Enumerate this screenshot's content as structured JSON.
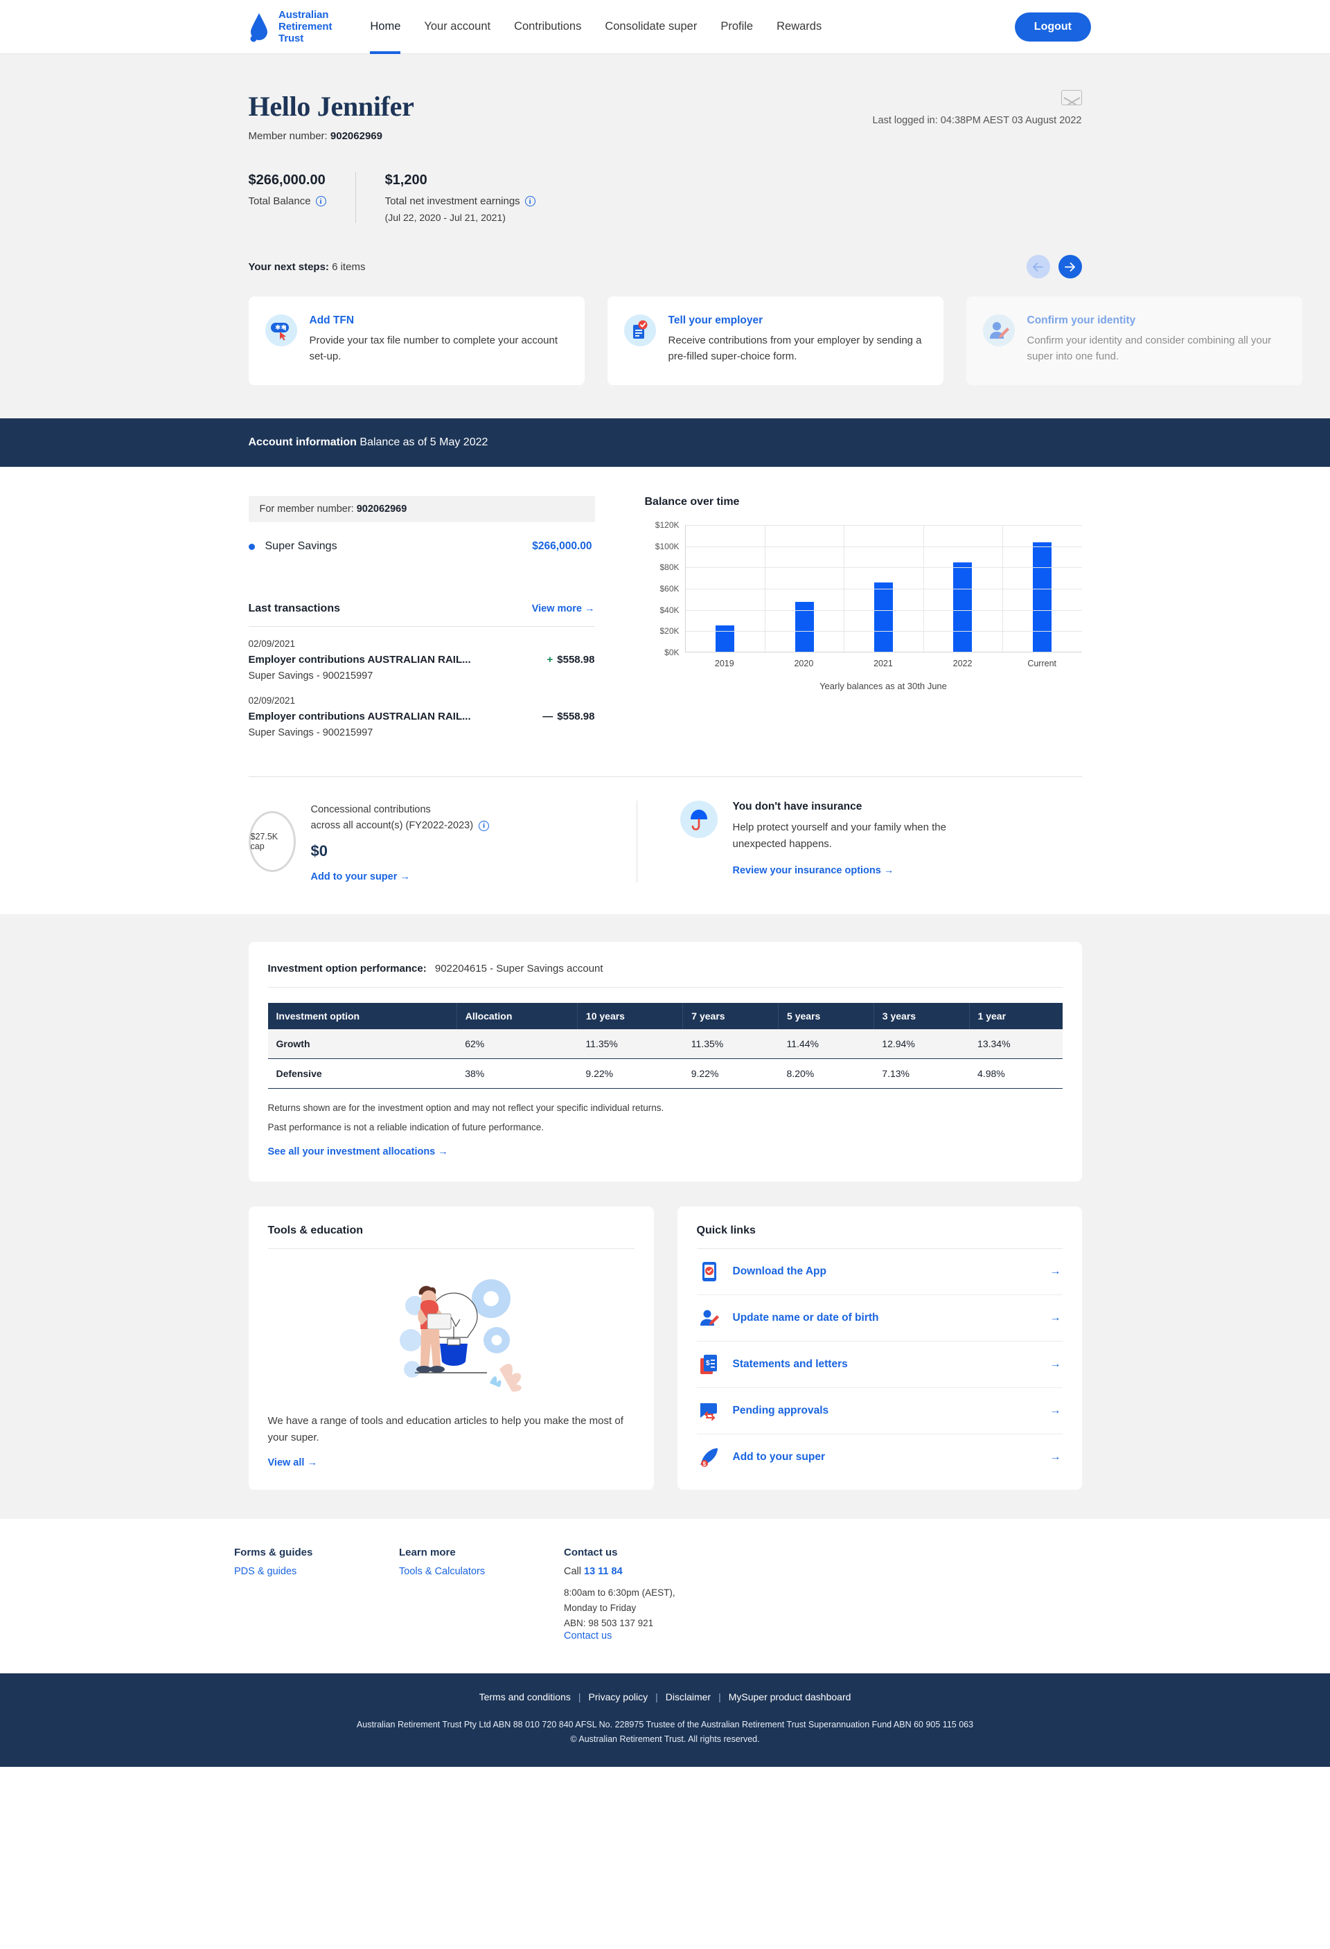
{
  "header": {
    "brand": {
      "line1": "Australian",
      "line2": "Retirement",
      "line3": "Trust"
    },
    "nav": [
      {
        "label": "Home",
        "active": true
      },
      {
        "label": "Your account",
        "active": false
      },
      {
        "label": "Contributions",
        "active": false
      },
      {
        "label": "Consolidate super",
        "active": false
      },
      {
        "label": "Profile",
        "active": false
      },
      {
        "label": "Rewards",
        "active": false
      }
    ],
    "logout_label": "Logout"
  },
  "hero": {
    "greeting": "Hello Jennifer",
    "member_label": "Member number:",
    "member_number": "902062969",
    "last_logged_in": "Last logged in: 04:38PM AEST 03 August 2022",
    "stats": [
      {
        "value": "$266,000.00",
        "label": "Total Balance",
        "sub": ""
      },
      {
        "value": "$1,200",
        "label": "Total net investment earnings",
        "sub": "(Jul 22, 2020 - Jul 21, 2021)"
      }
    ]
  },
  "next_steps": {
    "title_bold": "Your next steps:",
    "title_rest": "6 items",
    "prev_label": "←",
    "next_label": "→",
    "cards": [
      {
        "icon": "tfn-badge-icon",
        "title": "Add TFN",
        "desc": "Provide your tax file number to complete your account set-up."
      },
      {
        "icon": "clipboard-check-icon",
        "title": "Tell your employer",
        "desc": "Receive contributions from your employer by sending a pre-filled super-choice form."
      },
      {
        "icon": "person-edit-icon",
        "title": "Confirm your identity",
        "desc": "Confirm your identity and consider combining all your super into one fund."
      }
    ]
  },
  "account_bar": {
    "title": "Account information",
    "subtitle": "Balance as of 5 May 2022"
  },
  "account": {
    "member_pill_label": "For member number:",
    "member_pill_number": "902062969",
    "account_name": "Super Savings",
    "account_amount": "$266,000.00",
    "transactions_title": "Last transactions",
    "view_more": "View more →",
    "transactions": [
      {
        "date": "02/09/2021",
        "description": "Employer contributions AUSTRALIAN RAIL...",
        "sign": "+",
        "amount": "$558.98",
        "sub": "Super Savings - 900215997"
      },
      {
        "date": "02/09/2021",
        "description": "Employer contributions AUSTRALIAN RAIL...",
        "sign": "—",
        "amount": "$558.98",
        "sub": "Super Savings - 900215997"
      }
    ]
  },
  "chart_data": {
    "type": "bar",
    "title": "Balance over time",
    "categories": [
      "2019",
      "2020",
      "2021",
      "2022",
      "Current"
    ],
    "values": [
      25000,
      47000,
      65000,
      84000,
      103000
    ],
    "xlabel": "Yearly balances as at 30th June",
    "ylabel": "",
    "ylim": [
      0,
      120000
    ],
    "ytick_labels": [
      "$0K",
      "$20K",
      "$40K",
      "$60K",
      "$80K",
      "$100K",
      "$120K"
    ],
    "ytick_values": [
      0,
      20000,
      40000,
      60000,
      80000,
      100000,
      120000
    ],
    "grid": true,
    "legend": "none",
    "bar_color": "#0a5cf5"
  },
  "contributions": {
    "cap_label": "$27.5K cap",
    "line1": "Concessional contributions",
    "line2": "across all account(s) (FY2022-2023)",
    "amount": "$0",
    "link": "Add to your super →"
  },
  "insurance": {
    "icon": "umbrella-icon",
    "title": "You don't have insurance",
    "desc": "Help protect yourself and your family when the unexpected happens.",
    "link": "Review your insurance options →"
  },
  "investment": {
    "head_label": "Investment option performance:",
    "head_value": "902204615 - Super Savings account",
    "columns": [
      "Investment option",
      "Allocation",
      "10 years",
      "7 years",
      "5 years",
      "3 years",
      "1 year"
    ],
    "rows": [
      [
        "Growth",
        "62%",
        "11.35%",
        "11.35%",
        "11.44%",
        "12.94%",
        "13.34%"
      ],
      [
        "Defensive",
        "38%",
        "9.22%",
        "9.22%",
        "8.20%",
        "7.13%",
        "4.98%"
      ]
    ],
    "note1": "Returns shown are for the investment option and may not reflect your specific individual returns.",
    "note2": "Past performance is not a reliable indication of future performance.",
    "link": "See all your investment allocations →"
  },
  "tools": {
    "title": "Tools & education",
    "desc": "We have a range of tools and education articles to help you make the most of your super.",
    "link": "View all →"
  },
  "quick_links": {
    "title": "Quick links",
    "items": [
      {
        "icon": "mobile-app-icon",
        "label": "Download the App",
        "arrow": "→"
      },
      {
        "icon": "person-edit-icon",
        "label": "Update name or date of birth",
        "arrow": "→"
      },
      {
        "icon": "document-dollar-icon",
        "label": "Statements and letters",
        "arrow": "→"
      },
      {
        "icon": "chat-approval-icon",
        "label": "Pending approvals",
        "arrow": "→"
      },
      {
        "icon": "rocket-dollar-icon",
        "label": "Add to your super",
        "arrow": "→"
      }
    ]
  },
  "footer": {
    "columns": [
      {
        "heading": "Forms & guides",
        "link": "PDS & guides"
      },
      {
        "heading": "Learn more",
        "link": "Tools & Calculators"
      }
    ],
    "contact": {
      "heading": "Contact us",
      "call_prefix": "Call",
      "phone": "13 11 84",
      "hours_line1": "8:00am to 6:30pm (AEST),",
      "hours_line2": "Monday to Friday",
      "abn": "ABN: 98 503 137 921",
      "link": "Contact us"
    },
    "bottom_links": [
      "Terms and conditions",
      "Privacy policy",
      "Disclaimer",
      "MySuper product dashboard"
    ],
    "legal_line1": "Australian Retirement Trust Pty Ltd ABN 88 010 720 840 AFSL No. 228975 Trustee of the Australian Retirement Trust Superannuation Fund ABN 60 905 115 063",
    "legal_line2": "© Australian Retirement Trust. All rights reserved."
  },
  "colors": {
    "brand_blue": "#1964e0",
    "navy": "#1d3557",
    "bar_blue": "#0a5cf5",
    "green": "#138a55",
    "red": "#e8453c"
  }
}
